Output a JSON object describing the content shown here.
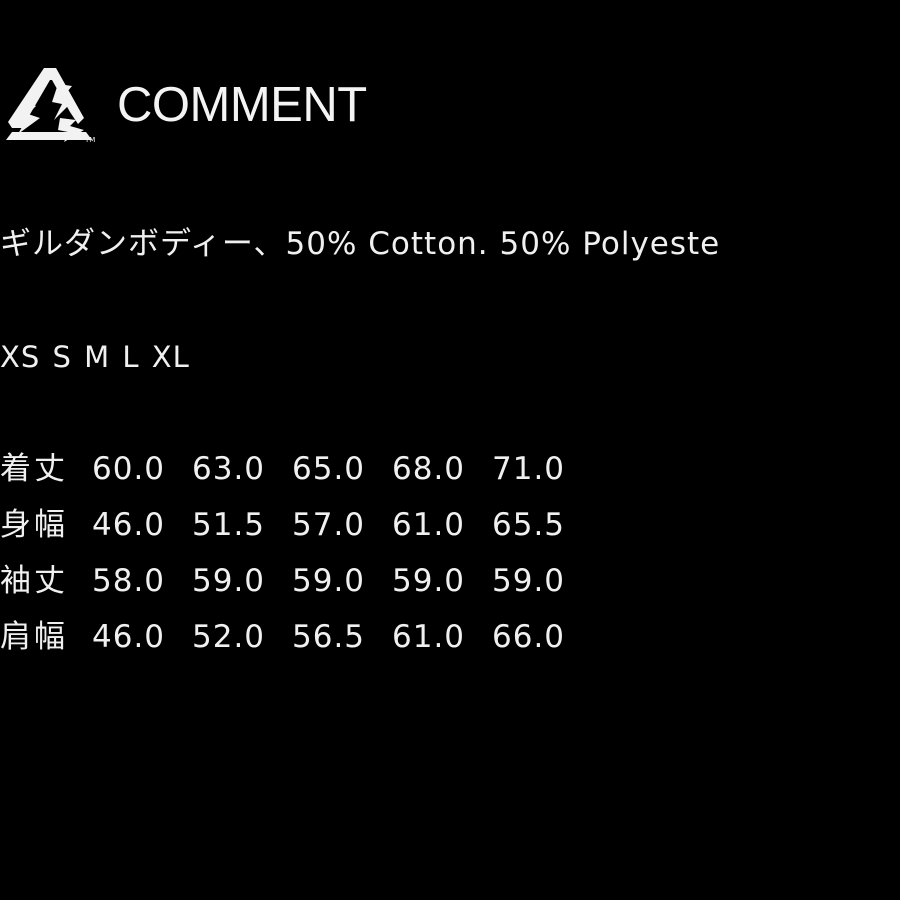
{
  "header": {
    "brand": "COMMENT",
    "logo_icon": "triangle-lightning-logo-icon"
  },
  "material": "ギルダンボディー、50% Cotton. 50% Polyeste",
  "sizes_line": "XS S M L XL",
  "measurements": [
    {
      "label": "着丈",
      "values": [
        "60.0",
        "63.0",
        "65.0",
        "68.0",
        "71.0"
      ]
    },
    {
      "label": "身幅",
      "values": [
        "46.0",
        "51.5",
        "57.0",
        "61.0",
        "65.5"
      ]
    },
    {
      "label": "袖丈",
      "values": [
        "58.0",
        "59.0",
        "59.0",
        "59.0",
        "59.0"
      ]
    },
    {
      "label": "肩幅",
      "values": [
        "46.0",
        "52.0",
        "56.5",
        "61.0",
        "66.0"
      ]
    }
  ],
  "colors": {
    "background": "#000000",
    "text": "#f0f0f0"
  }
}
